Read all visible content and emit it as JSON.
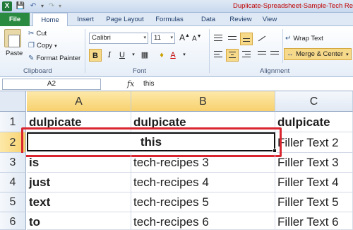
{
  "titlebar": {
    "app_icon": "X",
    "title": "Duplicate-Spreadsheet-Sample-Tech Re"
  },
  "tabs": [
    "File",
    "Home",
    "Insert",
    "Page Layout",
    "Formulas",
    "Data",
    "Review",
    "View"
  ],
  "ribbon": {
    "clipboard": {
      "paste": "Paste",
      "cut": "Cut",
      "copy": "Copy",
      "format_painter": "Format Painter",
      "label": "Clipboard"
    },
    "font": {
      "name": "Calibri",
      "size": "11",
      "bold": "B",
      "italic": "I",
      "underline": "U",
      "grow": "A",
      "shrink": "A",
      "font_color": "A",
      "fill_color": "A",
      "label": "Font"
    },
    "alignment": {
      "wrap_text": "Wrap Text",
      "merge_center": "Merge & Center",
      "label": "Alignment"
    }
  },
  "formula_bar": {
    "name_box": "A2",
    "fx": "fx",
    "content": "this"
  },
  "grid": {
    "columns": [
      "A",
      "B",
      "C"
    ],
    "rows": [
      {
        "num": "1",
        "a": "dulpicate",
        "b": "dulpicate",
        "c": "dulpicate"
      },
      {
        "num": "2",
        "merged": "this",
        "c": "Filler Text 2"
      },
      {
        "num": "3",
        "a": "is",
        "b": "tech-recipes  3",
        "c": "Filler Text 3"
      },
      {
        "num": "4",
        "a": "just",
        "b": "tech-recipes 4",
        "c": "Filler Text 4"
      },
      {
        "num": "5",
        "a": "text",
        "b": "tech-recipes  5",
        "c": "Filler Text 5"
      },
      {
        "num": "6",
        "a": "to",
        "b": "tech-recipes  6",
        "c": "Filler Text 6"
      }
    ]
  },
  "colors": {
    "file_tab": "#2a8a3f",
    "active_header": "#f7d16e",
    "highlight_frame": "#d9262f"
  }
}
